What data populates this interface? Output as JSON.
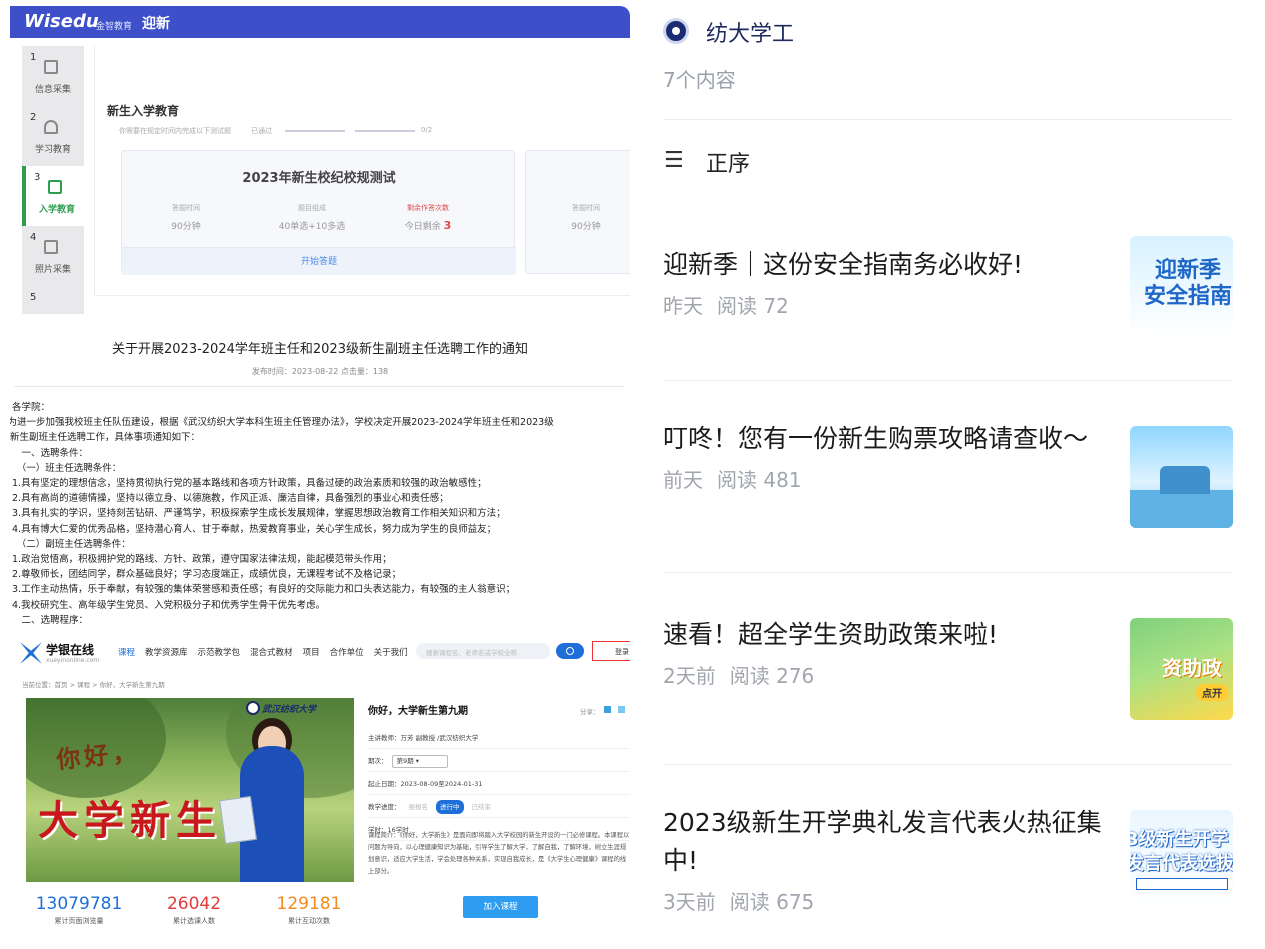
{
  "wisedu": {
    "logo": "Wisedu",
    "logo_sub": "金智教育",
    "title": "迎新",
    "steps": [
      {
        "num": "1",
        "label": "信息采集"
      },
      {
        "num": "2",
        "label": "学习教育"
      },
      {
        "num": "3",
        "label": "入学教育"
      },
      {
        "num": "4",
        "label": "照片采集"
      },
      {
        "num": "5",
        "label": ""
      }
    ],
    "section_title": "新生入学教育",
    "tip": "你需要在规定时间内完成以下测试题",
    "passed_label": "已通过",
    "progress": "0/2",
    "card_title": "2023年新生校纪校规测试",
    "cols": [
      {
        "k": "答题时间",
        "v": "90分钟"
      },
      {
        "k": "题目组成",
        "v": "40单选+10多选"
      },
      {
        "k": "剩余作答次数",
        "v_prefix": "今日剩余",
        "v_num": "3"
      },
      {
        "k": "答题时间",
        "v": "90分钟"
      }
    ],
    "start_label": "开始答题"
  },
  "notice": {
    "title": "关于开展2023-2024学年班主任和2023级新生副班主任选聘工作的通知",
    "meta": "发布时间：2023-08-22   点击量：138",
    "lines": [
      "各学院：",
      "　为进一步加强我校班主任队伍建设，根据《武汉纺织大学本科生班主任管理办法》，学校决定开展2023-2024学年班主任和2023级",
      "新生副班主任选聘工作，具体事项通知如下：",
      "　一、选聘条件：",
      "　（一）班主任选聘条件：",
      "1.具有坚定的理想信念，坚持贯彻执行党的基本路线和各项方针政策，具备过硬的政治素质和较强的政治敏感性；",
      "2.具有高尚的道德情操，坚持以德立身、以德施教，作风正派、廉洁自律，具备强烈的事业心和责任感；",
      "3.具有扎实的学识，坚持刻苦钻研、严谨笃学，积极探索学生成长发展规律，掌握思想政治教育工作相关知识和方法；",
      "4.具有博大仁爱的优秀品格，坚持潜心育人、甘于奉献，热爱教育事业，关心学生成长，努力成为学生的良师益友；",
      "　（二）副班主任选聘条件：",
      "1.政治觉悟高，积极拥护党的路线、方针、政策，遵守国家法律法规，能起模范带头作用；",
      "2.尊敬师长，团结同学，群众基础良好；学习态度端正，成绩优良，无课程考试不及格记录；",
      "3.工作主动热情，乐于奉献，有较强的集体荣誉感和责任感；有良好的交际能力和口头表达能力，有较强的主人翁意识；",
      "4.我校研究生、高年级学生党员、入党积极分子和优秀学生骨干优先考虑。",
      "　二、选聘程序："
    ]
  },
  "xueyin": {
    "logo": "学银在线",
    "logo_sub": "xueyinonline.com",
    "nav": [
      "课程",
      "教学资源库",
      "示范教学包",
      "混合式教材",
      "项目",
      "合作单位",
      "关于我们"
    ],
    "search_placeholder": "搜索课程名、老师名或学校全称",
    "login": "登录",
    "crumb": "当前位置：首页 > 课程 > 你好，大学新生第九期",
    "hero_hello": "你好，",
    "hero_big": "大学新生",
    "hero_uni": "武汉纺织大学",
    "course_title": "你好，大学新生第九期",
    "share": "分享：",
    "teacher": "主讲教师：万芳 副教授 /武汉纺织大学",
    "term_label": "期次：",
    "term_value": "第9期",
    "date": "起止日期：2023-08-09至2024-01-31",
    "progress_label": "教学进度：",
    "progress_states": [
      "报报名",
      "进行中",
      "已结束"
    ],
    "hours": "学时：16学时",
    "desc": "课程简介：《你好，大学新生》是面向即将踏入大学校园的新生开设的一门必修课程。本课程以问题为导向，以心理健康知识为基础，引导学生了解大学，了解自我，了解环境，树立生涯规划意识，适应大学生活，学会处理各种关系，实现自我成长，是《大学生心理健康》课程的线上部分。",
    "stats": [
      {
        "n": "13079781",
        "l": "累计页面浏览量",
        "color": "#1e6fd8"
      },
      {
        "n": "26042",
        "l": "累计选课人数",
        "color": "#e33b3b"
      },
      {
        "n": "129181",
        "l": "累计互动次数",
        "color": "#f28a1d"
      }
    ],
    "join": "加入课程"
  },
  "account": {
    "name": "纺大学工",
    "count": "7个内容",
    "sort_label": "正序"
  },
  "articles": [
    {
      "title": "迎新季｜这份安全指南务必收好!",
      "time": "昨天",
      "reads": "阅读 72",
      "thumb_text": "迎新季\n安全指南"
    },
    {
      "title": "叮咚！您有一份新生购票攻略请查收～",
      "time": "前天",
      "reads": "阅读 481",
      "thumb_text": ""
    },
    {
      "title": "速看！超全学生资助政策来啦!",
      "time": "2天前",
      "reads": "阅读 276",
      "thumb_text": "资助政\n点开"
    },
    {
      "title": "2023级新生开学典礼发言代表火热征集中!",
      "time": "3天前",
      "reads": "阅读 675",
      "thumb_text": "3级新生开学\n发言代表选拔"
    }
  ]
}
